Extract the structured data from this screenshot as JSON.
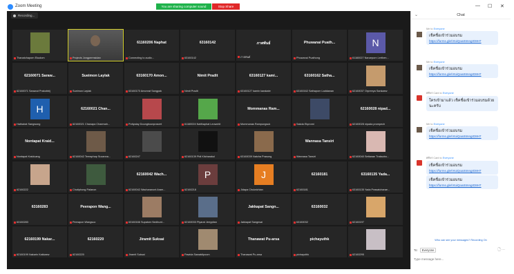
{
  "window": {
    "title": "Zoom Meeting",
    "minimize": "—",
    "maximize": "☐",
    "close": "✕"
  },
  "share_banner": {
    "text": "You are sharing computer sound",
    "stop_label": "Stop Share"
  },
  "recording": {
    "label": "Recording..."
  },
  "tiles": [
    {
      "name": "",
      "label": "Thanatchaporn Ekudom",
      "avatar": "photo",
      "color": "#6b7a3c"
    },
    {
      "name": "",
      "label": "Projects Jongpermsidan",
      "avatar": "video",
      "color": "#555",
      "active": true
    },
    {
      "name": "61160206 Naphat",
      "label": "Connecting to audio...",
      "avatar": "none"
    },
    {
      "name": "63160142",
      "label": "63160142",
      "avatar": "none"
    },
    {
      "name": "ภาสพันธ์",
      "label": "ภาสพันธ์",
      "avatar": "none"
    },
    {
      "name": "Phuwanai Puath...",
      "label": "Phuwanai Puathong",
      "avatar": "none"
    },
    {
      "name": "",
      "label": "61160027 Narueporn Lertben...",
      "avatar": "letter",
      "letter": "N",
      "color": "#5b59a8"
    },
    {
      "name": "62160071 Saraw...",
      "label": "62160071 Sarawut Prakobbij",
      "avatar": "none"
    },
    {
      "name": "Sueimon Laylak",
      "label": "Sueimon Laylak",
      "avatar": "none"
    },
    {
      "name": "63160170 Amon...",
      "label": "63160170 Amonrat Sangpak",
      "avatar": "none"
    },
    {
      "name": "Nimit Pradit",
      "label": "Nimit Pradit",
      "avatar": "none"
    },
    {
      "name": "63160127 kami...",
      "label": "63160127 kamin karakate",
      "avatar": "none"
    },
    {
      "name": "63160162 Satha...",
      "label": "63160162 Sathaporn Laddawan",
      "avatar": "none"
    },
    {
      "name": "",
      "label": "62160037 Orpreeya Sankaew",
      "avatar": "photo",
      "color": "#c59b6d"
    },
    {
      "name": "",
      "label": "Hathairat Sangwong",
      "avatar": "letter",
      "letter": "H",
      "color": "#1f5fae"
    },
    {
      "name": "62160021 Chan...",
      "label": "62160021 Chanapa Chaemah...",
      "avatar": "none"
    },
    {
      "name": "",
      "label": "Pottyalay Doungboonprasert",
      "avatar": "photo",
      "color": "#b7484c"
    },
    {
      "name": "",
      "label": "61160024 Natthaphat Leowchit",
      "avatar": "photo",
      "color": "#55a74a"
    },
    {
      "name": "Mommanas Ram...",
      "label": "Mommanas Rampungsuk",
      "avatar": "none"
    },
    {
      "name": "",
      "label": "Sakda Ekpromi",
      "avatar": "photo",
      "color": "#3d4a66"
    },
    {
      "name": "62160028 nipad...",
      "label": "62160028 nipada prompech",
      "avatar": "none"
    },
    {
      "name": "Nontapat Kraid...",
      "label": "Nontapat Kraiduang",
      "avatar": "none"
    },
    {
      "name": "",
      "label": "62160042 Teeraphap Suvanna...",
      "avatar": "photo",
      "color": "#6e5a48"
    },
    {
      "name": "",
      "label": "62160247",
      "avatar": "photo",
      "color": "#4b4b4b"
    },
    {
      "name": "",
      "label": "62160139 Pidi Kitcharakul",
      "avatar": "photo",
      "color": "#111"
    },
    {
      "name": "",
      "label": "63160039 Natcha Prasong",
      "avatar": "photo",
      "color": "#8a6a4c"
    },
    {
      "name": "Wannasa Tansiri",
      "label": "Wannasa Tansiri",
      "avatar": "none"
    },
    {
      "name": "",
      "label": "62160040 Settanan Traksobo...",
      "avatar": "photo",
      "color": "#d9b8b2"
    },
    {
      "name": "",
      "label": "62160222",
      "avatar": "photo",
      "color": "#c7a58c"
    },
    {
      "name": "",
      "label": "Chutiphong Palanon",
      "avatar": "photo",
      "color": "#3e5a3e"
    },
    {
      "name": "62160042 Wach...",
      "label": "62160042 Wacharanont Aram...",
      "avatar": "none"
    },
    {
      "name": "",
      "label": "62160218",
      "avatar": "letter",
      "letter": "P",
      "color": "#6b3d3d"
    },
    {
      "name": "",
      "label": "Jidapa Chulwichian",
      "avatar": "letter",
      "letter": "J",
      "color": "#e67e22"
    },
    {
      "name": "62160181",
      "label": "62160181",
      "avatar": "none"
    },
    {
      "name": "63160135 Yada...",
      "label": "63160135 Yada Prawatcharae...",
      "avatar": "none"
    },
    {
      "name": "63160283",
      "label": "63160283",
      "avatar": "none"
    },
    {
      "name": "Peerapon Wang...",
      "label": "Peerapon Wangsuo",
      "avatar": "none"
    },
    {
      "name": "",
      "label": "63160166 Supatorn Nedbunt...",
      "avatar": "photo",
      "color": "#9c7c64"
    },
    {
      "name": "",
      "label": "62160033 Piyarat Jeeyplian",
      "avatar": "photo",
      "color": "#5a6e8a"
    },
    {
      "name": "Jakkapat Sangn...",
      "label": "Jakkapat Sangnsai",
      "avatar": "none"
    },
    {
      "name": "63160032",
      "label": "63160032",
      "avatar": "none"
    },
    {
      "name": "",
      "label": "62160197",
      "avatar": "photo",
      "color": "#d8a66a"
    },
    {
      "name": "62160199 Nakar...",
      "label": "62160199 Nakarin Kakkaew",
      "avatar": "none"
    },
    {
      "name": "62160220",
      "label": "62160220",
      "avatar": "none"
    },
    {
      "name": "Jiramit Suksai",
      "label": "Jiramit Suksai",
      "avatar": "none"
    },
    {
      "name": "",
      "label": "Pawida Sawatdipoom",
      "avatar": "photo",
      "color": "#a08a70"
    },
    {
      "name": "Thanawat Pu-arsa",
      "label": "Thanawat Pu-arsa",
      "avatar": "none"
    },
    {
      "name": "pichayuthk",
      "label": "pichayuthk",
      "avatar": "none"
    },
    {
      "name": "",
      "label": "62160295",
      "avatar": "photo",
      "color": "#c8bfc5"
    }
  ],
  "chat": {
    "title": "Chat",
    "collapse": "⌄",
    "messages": [
      {
        "sender": "Me",
        "to": "Everyone",
        "text": "เช็คชื่อเข้าร่วมอบรม",
        "link": "https://forms.gle/VtoiQoaStmngrD8H7",
        "avatar": "photo"
      },
      {
        "sender": "Me",
        "to": "Everyone",
        "text": "เช็คชื่อเข้าร่วมอบรม",
        "link": "https://forms.gle/VtoiQoaStmngrD8H7",
        "avatar": "photo"
      },
      {
        "sender": "ศศิพร Cant",
        "to": "Everyone",
        "text": "ใครเข้ามาแล้ว เช็คชื่อเข้าร่วมอบรมด้วยนะครับ",
        "link": "",
        "avatar": "red"
      },
      {
        "sender": "Me",
        "to": "Everyone",
        "text": "เช็คชื่อเข้าร่วมอบรม",
        "link": "https://forms.gle/VtoiQoaStmngrD8H7",
        "avatar": "photo"
      },
      {
        "sender": "ศศิพร Cant",
        "to": "Everyone",
        "text": "เช็คชื่อเข้าร่วมอบรม",
        "link": "https://forms.gle/VtoiQoaStmngrD8H7",
        "avatar": "red",
        "extra_text": "เช็คชื่อเข้าร่วมอบรม",
        "extra_link": "https://forms.gle/VtoiQoaStmngrD8H7"
      }
    ],
    "privacy": "Who can see your messages? Recording On",
    "to_label": "To:",
    "to_value": "Everyone",
    "input_placeholder": "Type message here..."
  }
}
